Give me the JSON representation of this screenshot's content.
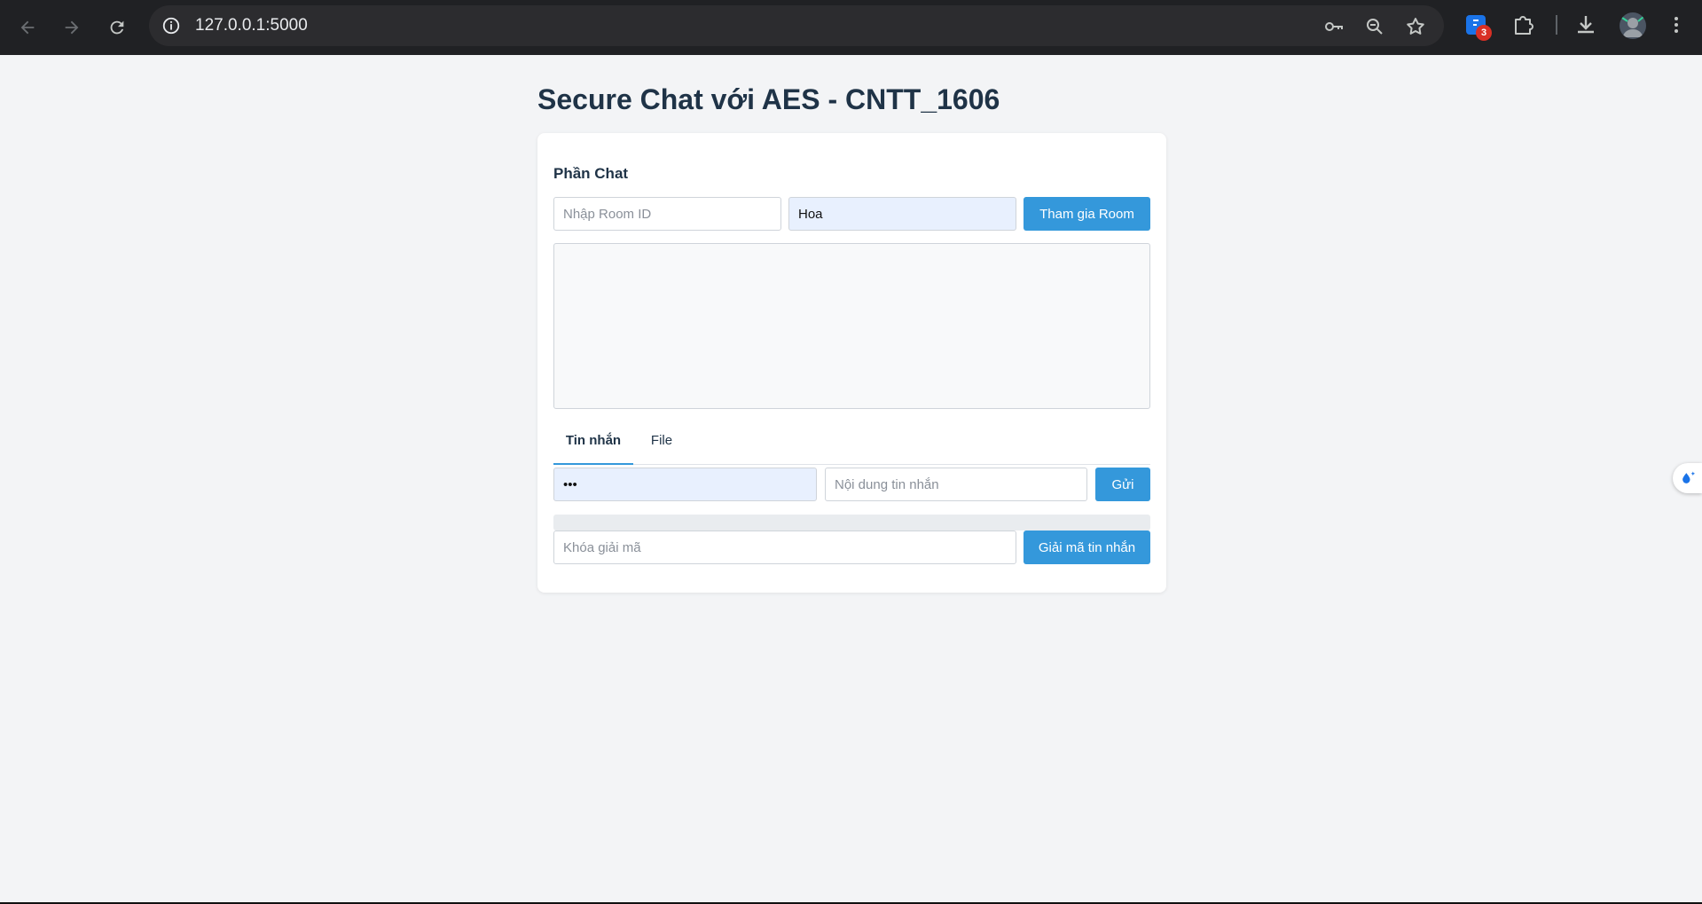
{
  "browser": {
    "url": "127.0.0.1:5000",
    "extension_badge_count": "3",
    "icons": {
      "back": "arrow-left-icon",
      "forward": "arrow-right-icon",
      "reload": "reload-icon",
      "site_info": "info-icon",
      "password": "key-icon",
      "zoom": "zoom-out-icon",
      "bookmark": "star-icon",
      "extensions": "puzzle-icon",
      "downloads": "download-icon",
      "menu": "kebab-menu-icon"
    }
  },
  "page": {
    "title": "Secure Chat với AES - CNTT_1606"
  },
  "chat": {
    "section_title": "Phần Chat",
    "room": {
      "room_id_placeholder": "Nhập Room ID",
      "room_id_value": "",
      "username_value": "Hoa",
      "join_button": "Tham gia Room"
    },
    "tabs": [
      {
        "label": "Tin nhắn",
        "active": true
      },
      {
        "label": "File",
        "active": false
      }
    ],
    "message": {
      "key_value": "•••",
      "content_placeholder": "Nội dung tin nhắn",
      "send_button": "Gửi"
    },
    "progress": 0,
    "decrypt": {
      "key_placeholder": "Khóa giải mã",
      "button": "Giải mã tin nhắn"
    }
  },
  "colors": {
    "accent": "#3498db",
    "title": "#1f3347",
    "page_bg": "#f3f4f6",
    "chrome_bg": "#202124",
    "autofill_bg": "#e8f0fe"
  }
}
